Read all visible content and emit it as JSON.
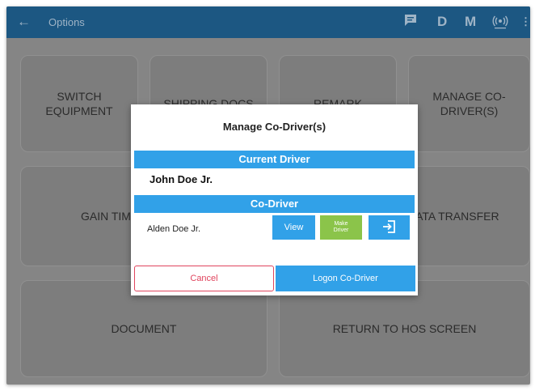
{
  "appbar": {
    "title": "Options",
    "icons": [
      "back-arrow",
      "message-icon",
      "D",
      "M",
      "wireless-icon",
      "more-vert-icon"
    ],
    "d_label": "D",
    "m_label": "M"
  },
  "tiles": {
    "switch_equipment": "SWITCH EQUIPMENT",
    "shipping_docs": "SHIPPING DOCS",
    "remark": "REMARK",
    "manage_codrivers": "MANAGE CO-DRIVER(S)",
    "gain_time": "GAIN TIME",
    "data_transfer": "DATA TRANSFER",
    "document": "DOCUMENT",
    "return_hos": "RETURN TO HOS SCREEN"
  },
  "dialog": {
    "title": "Manage Co-Driver(s)",
    "current_driver_header": "Current Driver",
    "current_driver_name": "John Doe Jr.",
    "codriver_header": "Co-Driver",
    "codriver_name": "Alden Doe Jr.",
    "view_label": "View",
    "make_driver_label": "Make Driver",
    "cancel_label": "Cancel",
    "logon_label": "Logon Co-Driver"
  },
  "colors": {
    "appbar": "#1c5782",
    "accent": "#31a1e8",
    "make_driver": "#8bc44a",
    "cancel": "#e0455e"
  }
}
